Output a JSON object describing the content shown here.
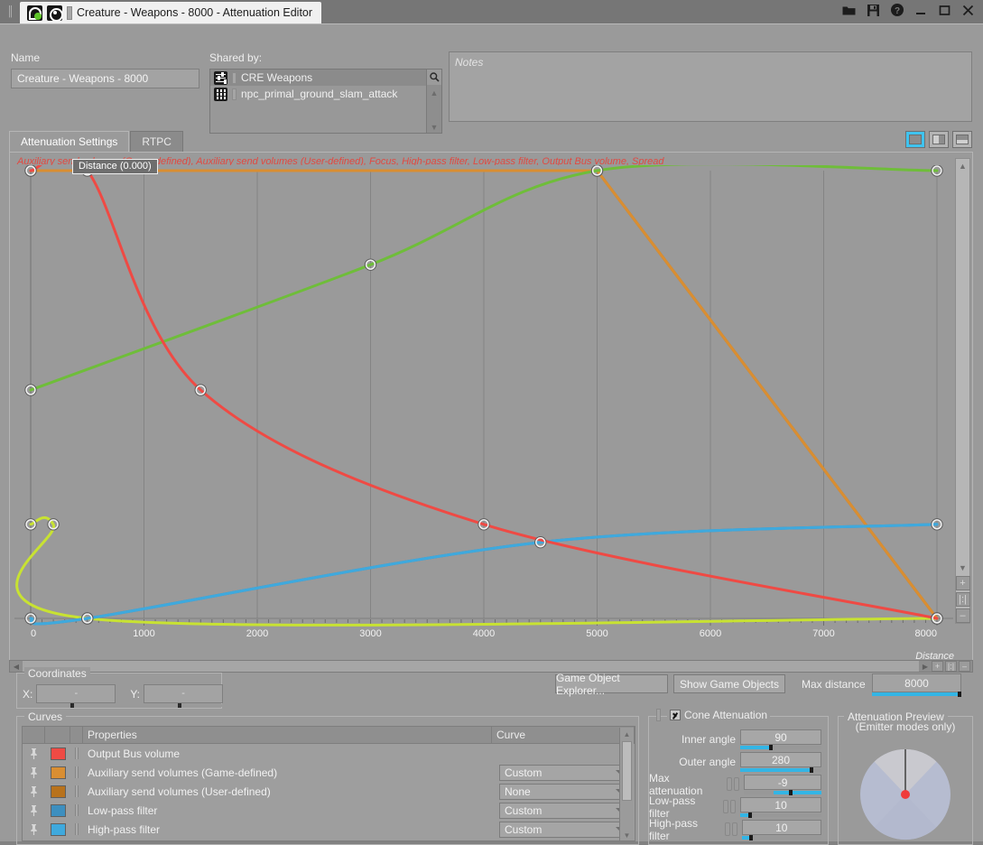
{
  "window": {
    "tab_title": "Creature - Weapons - 8000 - Attenuation Editor",
    "buttons": [
      {
        "name": "open-icon",
        "glyph": "folder"
      },
      {
        "name": "save-icon",
        "glyph": "floppy"
      },
      {
        "name": "help-icon",
        "glyph": "question"
      },
      {
        "name": "minimize-icon",
        "glyph": "minimize"
      },
      {
        "name": "maximize-icon",
        "glyph": "maximize"
      },
      {
        "name": "close-icon",
        "glyph": "close"
      }
    ]
  },
  "name_group": {
    "label": "Name",
    "value": "Creature - Weapons - 8000"
  },
  "shared_by": {
    "label": "Shared by:",
    "items": [
      {
        "text": "CRE Weapons",
        "icon": "slider-icon",
        "selected": true
      },
      {
        "text": "npc_primal_ground_slam_attack",
        "icon": "grid-icon",
        "selected": false
      }
    ],
    "search_icon": "search-icon"
  },
  "notes": {
    "placeholder": "Notes",
    "value": ""
  },
  "tabs": [
    {
      "label": "Attenuation Settings",
      "active": true
    },
    {
      "label": "RTPC",
      "active": false
    }
  ],
  "view_modes": [
    {
      "name": "single-pane",
      "active": true
    },
    {
      "name": "vertical-split",
      "active": false
    },
    {
      "name": "horizontal-split",
      "active": false
    }
  ],
  "graph": {
    "legend": "Auxiliary send volumes (Game-defined), Auxiliary send volumes (User-defined), Focus, High-pass filter, Low-pass filter, Output Bus volume, Spread",
    "tooltip": "Distance (0.000)"
  },
  "chart_data": {
    "type": "line",
    "title": "",
    "xlabel": "Distance",
    "ylabel": "",
    "xlim": [
      0,
      8000
    ],
    "ylim": [
      0,
      100
    ],
    "x_ticks": [
      0,
      1000,
      2000,
      3000,
      4000,
      5000,
      6000,
      7000,
      8000
    ],
    "minor_tick_step": 100,
    "grid": true,
    "gridlines_x": [
      1000,
      2000,
      3000,
      4000,
      5000,
      6000,
      7000
    ],
    "legend_position": "top-left",
    "series": [
      {
        "name": "Output Bus volume",
        "color": "#ef4a44",
        "points": [
          {
            "x": 0,
            "y": 100
          },
          {
            "x": 500,
            "y": 100
          },
          {
            "x": 1500,
            "y": 51
          },
          {
            "x": 4000,
            "y": 21
          },
          {
            "x": 8000,
            "y": 0
          }
        ]
      },
      {
        "name": "Auxiliary send volumes (Game-defined)",
        "color": "#d98e32",
        "points": [
          {
            "x": 0,
            "y": 100
          },
          {
            "x": 5000,
            "y": 100
          },
          {
            "x": 8000,
            "y": 0
          }
        ]
      },
      {
        "name": "Auxiliary send volumes (User-defined)",
        "color": "#b8721c",
        "points": [
          {
            "x": 0,
            "y": 100
          },
          {
            "x": 5000,
            "y": 100
          },
          {
            "x": 8000,
            "y": 0
          }
        ]
      },
      {
        "name": "Low-pass filter",
        "color": "#3d8fbf",
        "points": [
          {
            "x": 0,
            "y": 0
          },
          {
            "x": 500,
            "y": 0
          },
          {
            "x": 4500,
            "y": 17
          },
          {
            "x": 8000,
            "y": 21
          }
        ]
      },
      {
        "name": "High-pass filter",
        "color": "#3fa9dd",
        "points": [
          {
            "x": 0,
            "y": 0
          },
          {
            "x": 500,
            "y": 0
          },
          {
            "x": 4500,
            "y": 17
          },
          {
            "x": 8000,
            "y": 21
          }
        ]
      },
      {
        "name": "Focus",
        "color": "#6fbd3a",
        "points": [
          {
            "x": 0,
            "y": 51
          },
          {
            "x": 3000,
            "y": 79
          },
          {
            "x": 5000,
            "y": 100
          },
          {
            "x": 8000,
            "y": 100
          }
        ]
      },
      {
        "name": "Spread",
        "color": "#c8e232",
        "points": [
          {
            "x": 0,
            "y": 21
          },
          {
            "x": 200,
            "y": 21
          },
          {
            "x": 500,
            "y": 0
          },
          {
            "x": 8000,
            "y": 0
          }
        ]
      }
    ]
  },
  "coordinates": {
    "label": "Coordinates",
    "x_label": "X:",
    "x_value": "-",
    "y_label": "Y:",
    "y_value": "-"
  },
  "actions": {
    "game_object_explorer": "Game Object Explorer...",
    "show_game_objects": "Show Game Objects",
    "max_distance_label": "Max distance",
    "max_distance_value": "8000"
  },
  "curves": {
    "title": "Curves",
    "columns": [
      "",
      "",
      "",
      "Properties",
      "Curve"
    ],
    "rows": [
      {
        "color": "#ef4a44",
        "property": "Output Bus volume",
        "curve": ""
      },
      {
        "color": "#d98e32",
        "property": "Auxiliary send volumes (Game-defined)",
        "curve": "Custom"
      },
      {
        "color": "#b8721c",
        "property": "Auxiliary send volumes (User-defined)",
        "curve": "None"
      },
      {
        "color": "#3d8fbf",
        "property": "Low-pass filter",
        "curve": "Custom"
      },
      {
        "color": "#3fa9dd",
        "property": "High-pass filter",
        "curve": "Custom"
      }
    ]
  },
  "cone": {
    "title": "Cone Attenuation",
    "checked": true,
    "rows": [
      {
        "label": "Inner angle",
        "value": "90",
        "fill": 38,
        "knob": 38,
        "linked": false,
        "mode": "left"
      },
      {
        "label": "Outer angle",
        "value": "280",
        "fill": 88,
        "knob": 88,
        "linked": false,
        "mode": "left"
      },
      {
        "label": "Max attenuation",
        "value": "-9",
        "fill": 38,
        "knob": 60,
        "linked": true,
        "mode": "right"
      },
      {
        "label": "Low-pass filter",
        "value": "10",
        "fill": 12,
        "knob": 12,
        "linked": true,
        "mode": "left"
      },
      {
        "label": "High-pass filter",
        "value": "10",
        "fill": 12,
        "knob": 12,
        "linked": true,
        "mode": "left"
      }
    ]
  },
  "preview": {
    "title": "Attenuation Preview",
    "subtitle": "(Emitter modes only)",
    "inner_color": "#c9c9cf",
    "outer_color": "#b6bcd0",
    "emitter_color": "#ef3b3b"
  }
}
